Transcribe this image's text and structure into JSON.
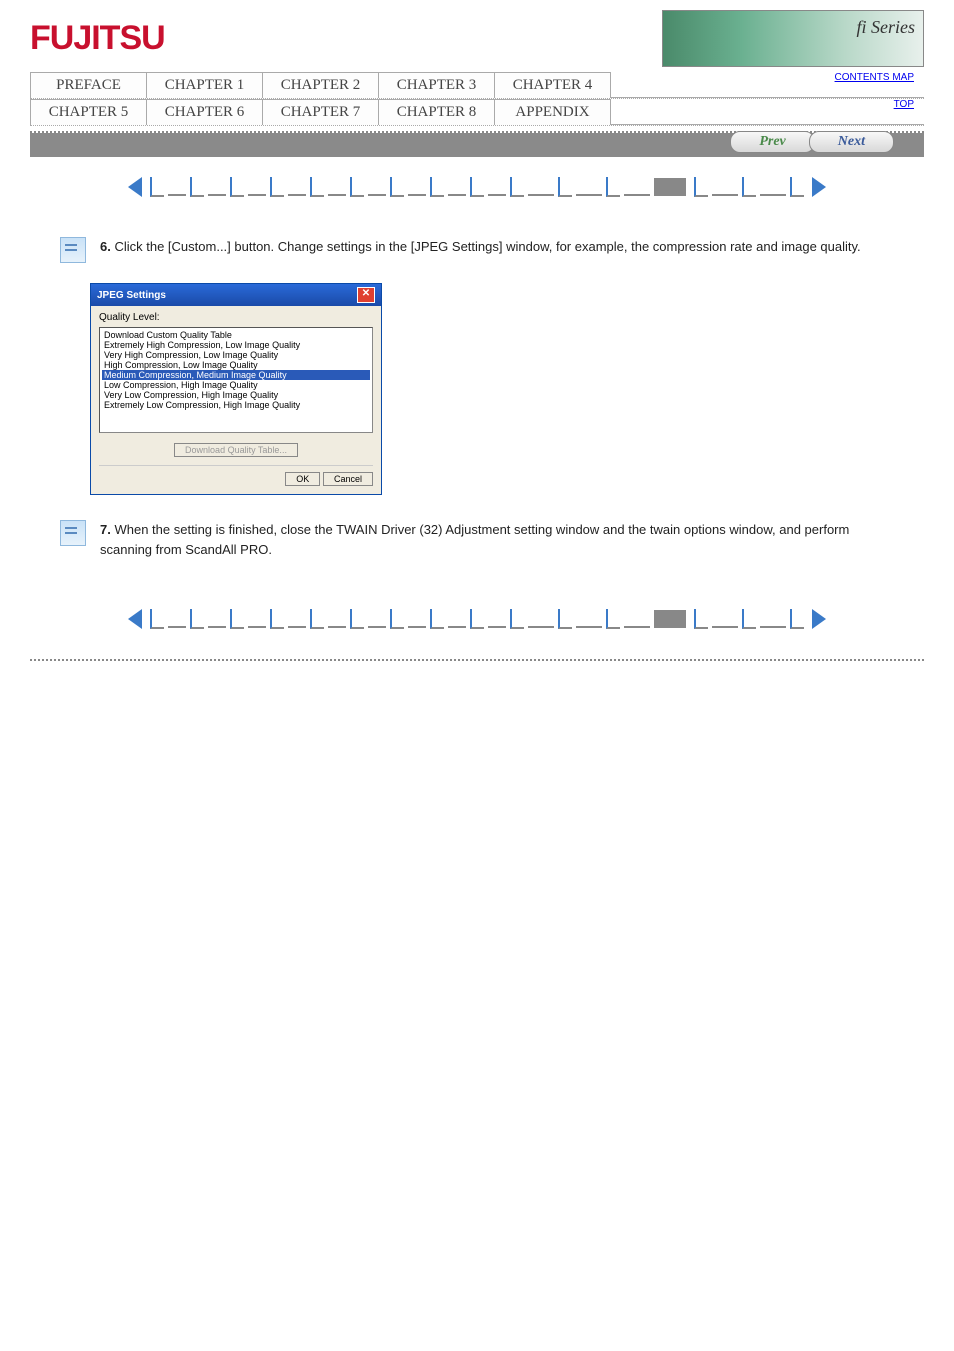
{
  "header": {
    "logo": "FUJITSU",
    "banner_text": "fi Series"
  },
  "nav": {
    "row1": [
      "PREFACE",
      "CHAPTER 1",
      "CHAPTER 2",
      "CHAPTER 3",
      "CHAPTER 4"
    ],
    "row2": [
      "CHAPTER 5",
      "CHAPTER 6",
      "CHAPTER 7",
      "CHAPTER 8",
      "APPENDIX"
    ],
    "small_links": [
      "CONTENTS MAP",
      "TOP"
    ]
  },
  "paging": {
    "prev": "Prev",
    "next": "Next"
  },
  "steps": [
    {
      "num": "6.",
      "text": "Click the [Custom...] button. Change settings in the [JPEG Settings] window, for example, the compression rate and image quality."
    },
    {
      "num": "7.",
      "text": "When the setting is finished, close the TWAIN Driver (32) Adjustment setting window and the twain options window, and perform scanning from ScandAll PRO."
    }
  ],
  "dialog": {
    "title": "JPEG Settings",
    "label": "Quality Level:",
    "items": [
      "Download Custom Quality Table",
      "Extremely High Compression, Low Image Quality",
      "Very High Compression, Low Image Quality",
      "High Compression, Low Image Quality",
      "Medium Compression, Medium Image Quality",
      "Low Compression, High Image Quality",
      "Very Low Compression, High Image Quality",
      "Extremely Low Compression, High Image Quality"
    ],
    "selected_index": 4,
    "download_btn": "Download Quality Table...",
    "ok": "OK",
    "cancel": "Cancel"
  }
}
